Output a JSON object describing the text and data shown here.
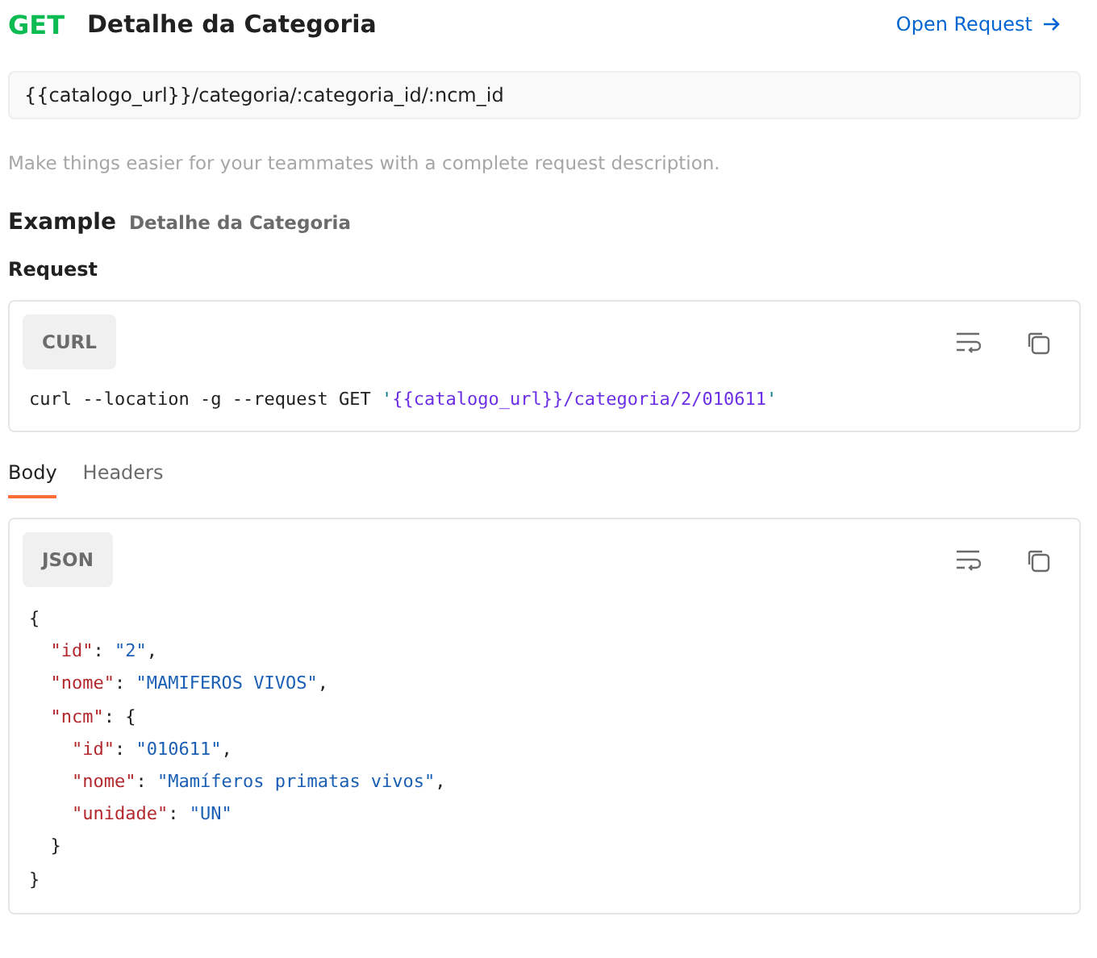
{
  "header": {
    "method": "GET",
    "title": "Detalhe da Categoria",
    "open_link": "Open Request"
  },
  "url": "{{catalogo_url}}/categoria/:categoria_id/:ncm_id",
  "description_placeholder": "Make things easier for your teammates with a complete request description.",
  "example": {
    "heading": "Example",
    "name": "Detalhe da Categoria"
  },
  "request": {
    "heading": "Request",
    "language": "CURL",
    "lines": [
      {
        "tokens": [
          {
            "kind": "plain",
            "text": "curl --location -g --request GET "
          },
          {
            "kind": "quote",
            "text": "'"
          },
          {
            "kind": "url",
            "text": "{{catalogo_url}}/categoria/2/010611"
          },
          {
            "kind": "quote",
            "text": "'"
          }
        ]
      }
    ]
  },
  "tabs": [
    {
      "label": "Body",
      "selected": true
    },
    {
      "label": "Headers",
      "selected": false
    }
  ],
  "response": {
    "language": "JSON",
    "lines": [
      {
        "tokens": [
          {
            "kind": "punct",
            "text": "{"
          }
        ]
      },
      {
        "tokens": [
          {
            "kind": "key",
            "text": "  \"id\""
          },
          {
            "kind": "punct",
            "text": ": "
          },
          {
            "kind": "string",
            "text": "\"2\""
          },
          {
            "kind": "punct",
            "text": ","
          }
        ]
      },
      {
        "tokens": [
          {
            "kind": "key",
            "text": "  \"nome\""
          },
          {
            "kind": "punct",
            "text": ": "
          },
          {
            "kind": "string",
            "text": "\"MAMIFEROS VIVOS\""
          },
          {
            "kind": "punct",
            "text": ","
          }
        ]
      },
      {
        "tokens": [
          {
            "kind": "key",
            "text": "  \"ncm\""
          },
          {
            "kind": "punct",
            "text": ": {"
          }
        ]
      },
      {
        "tokens": [
          {
            "kind": "key",
            "text": "    \"id\""
          },
          {
            "kind": "punct",
            "text": ": "
          },
          {
            "kind": "string",
            "text": "\"010611\""
          },
          {
            "kind": "punct",
            "text": ","
          }
        ]
      },
      {
        "tokens": [
          {
            "kind": "key",
            "text": "    \"nome\""
          },
          {
            "kind": "punct",
            "text": ": "
          },
          {
            "kind": "string",
            "text": "\"Mamíferos primatas vivos\""
          },
          {
            "kind": "punct",
            "text": ","
          }
        ]
      },
      {
        "tokens": [
          {
            "kind": "key",
            "text": "    \"unidade\""
          },
          {
            "kind": "punct",
            "text": ": "
          },
          {
            "kind": "string",
            "text": "\"UN\""
          }
        ]
      },
      {
        "tokens": [
          {
            "kind": "punct",
            "text": "  }"
          }
        ]
      },
      {
        "tokens": [
          {
            "kind": "punct",
            "text": "}"
          }
        ]
      }
    ]
  }
}
